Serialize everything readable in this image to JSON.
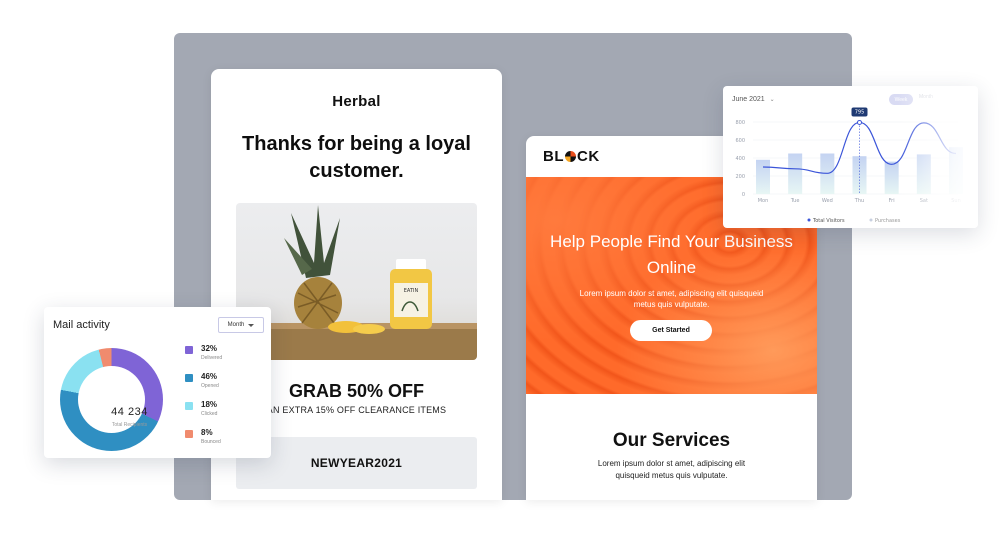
{
  "herbal": {
    "brand": "Herbal",
    "headline": "Thanks for being a loyal customer.",
    "offer": "GRAB 50% OFF",
    "sub": "AN EXTRA 15% OFF CLEARANCE ITEMS",
    "code": "NEWYEAR2021",
    "jar_label": "EATIN"
  },
  "block": {
    "logo_pre": "BL",
    "logo_post": "CK",
    "hero_title": "Help People Find Your Business Online",
    "hero_text": "Lorem ipsum dolor st amet, adipiscing elit quisqueid metus quis vulputate.",
    "cta": "Get Started",
    "services_title": "Our Services",
    "services_text": "Lorem ipsum dolor st amet, adipiscing elit quisqueid metus quis vulputate."
  },
  "mail": {
    "title": "Mail activity",
    "period": "Month",
    "total": "44 234",
    "total_label": "Total Recipients",
    "legend": [
      {
        "pct": "32%",
        "label": "Delivered",
        "color": "#7f64d6"
      },
      {
        "pct": "46%",
        "label": "Opened",
        "color": "#2f8fc2"
      },
      {
        "pct": "18%",
        "label": "Clicked",
        "color": "#8ae1f1"
      },
      {
        "pct": "8%",
        "label": "Bounced",
        "color": "#f08b6e"
      }
    ]
  },
  "analytics": {
    "date": "June 2021",
    "toggle_a": "Week",
    "toggle_b": "Month",
    "tooltip": "795",
    "legend_a": "Total Visitors",
    "legend_b": "Purchases"
  },
  "chart_data": {
    "type": "line",
    "categories": [
      "Mon",
      "Tue",
      "Wed",
      "Thu",
      "Fri",
      "Sat",
      "Sun"
    ],
    "yticks": [
      "800",
      "600",
      "400",
      "200",
      "0"
    ],
    "ylim": [
      0,
      800
    ],
    "series": [
      {
        "name": "Total Visitors",
        "values": [
          380,
          450,
          450,
          420,
          360,
          440,
          520
        ]
      },
      {
        "name": "Purchases",
        "values": [
          300,
          280,
          230,
          795,
          330,
          790,
          450
        ]
      }
    ],
    "accent": "#3b55d9"
  }
}
